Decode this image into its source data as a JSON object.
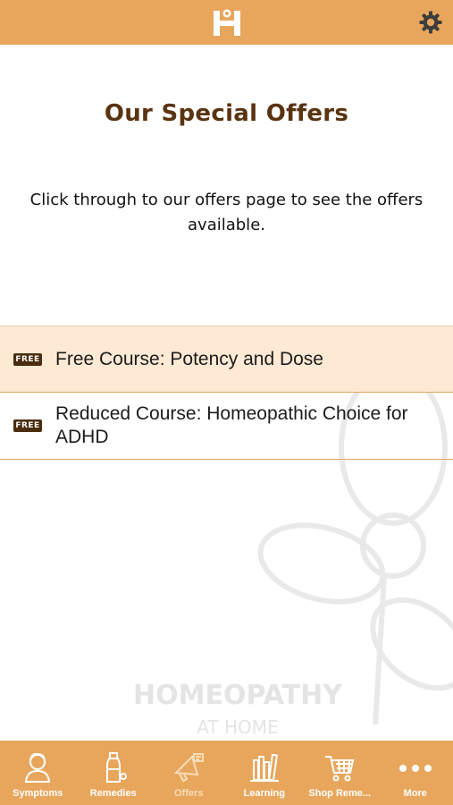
{
  "header": {
    "logo_icon": "homeopathy-h-logo",
    "settings_icon": "gear-icon",
    "background_color": "#e8a65c"
  },
  "main": {
    "title": "Our Special Offers",
    "subtitle": "Click through to our offers page to see the offers available.",
    "watermark_line1": "HOMEOPATHY",
    "watermark_line2": "AT HOME",
    "title_color": "#5a3310"
  },
  "offers": [
    {
      "badge": "FREE",
      "title": "Free Course: Potency and Dose",
      "selected": true
    },
    {
      "badge": "FREE",
      "title": "Reduced Course: Homeopathic Choice for ADHD",
      "selected": false
    }
  ],
  "tabs": [
    {
      "label": "Symptoms",
      "icon": "person-icon",
      "active": false
    },
    {
      "label": "Remedies",
      "icon": "bottle-icon",
      "active": false
    },
    {
      "label": "Offers",
      "icon": "megaphone-icon",
      "active": true
    },
    {
      "label": "Learning",
      "icon": "books-icon",
      "active": false
    },
    {
      "label": "Shop Reme...",
      "icon": "cart-icon",
      "active": false
    },
    {
      "label": "More",
      "icon": "more-dots-icon",
      "active": false
    }
  ]
}
